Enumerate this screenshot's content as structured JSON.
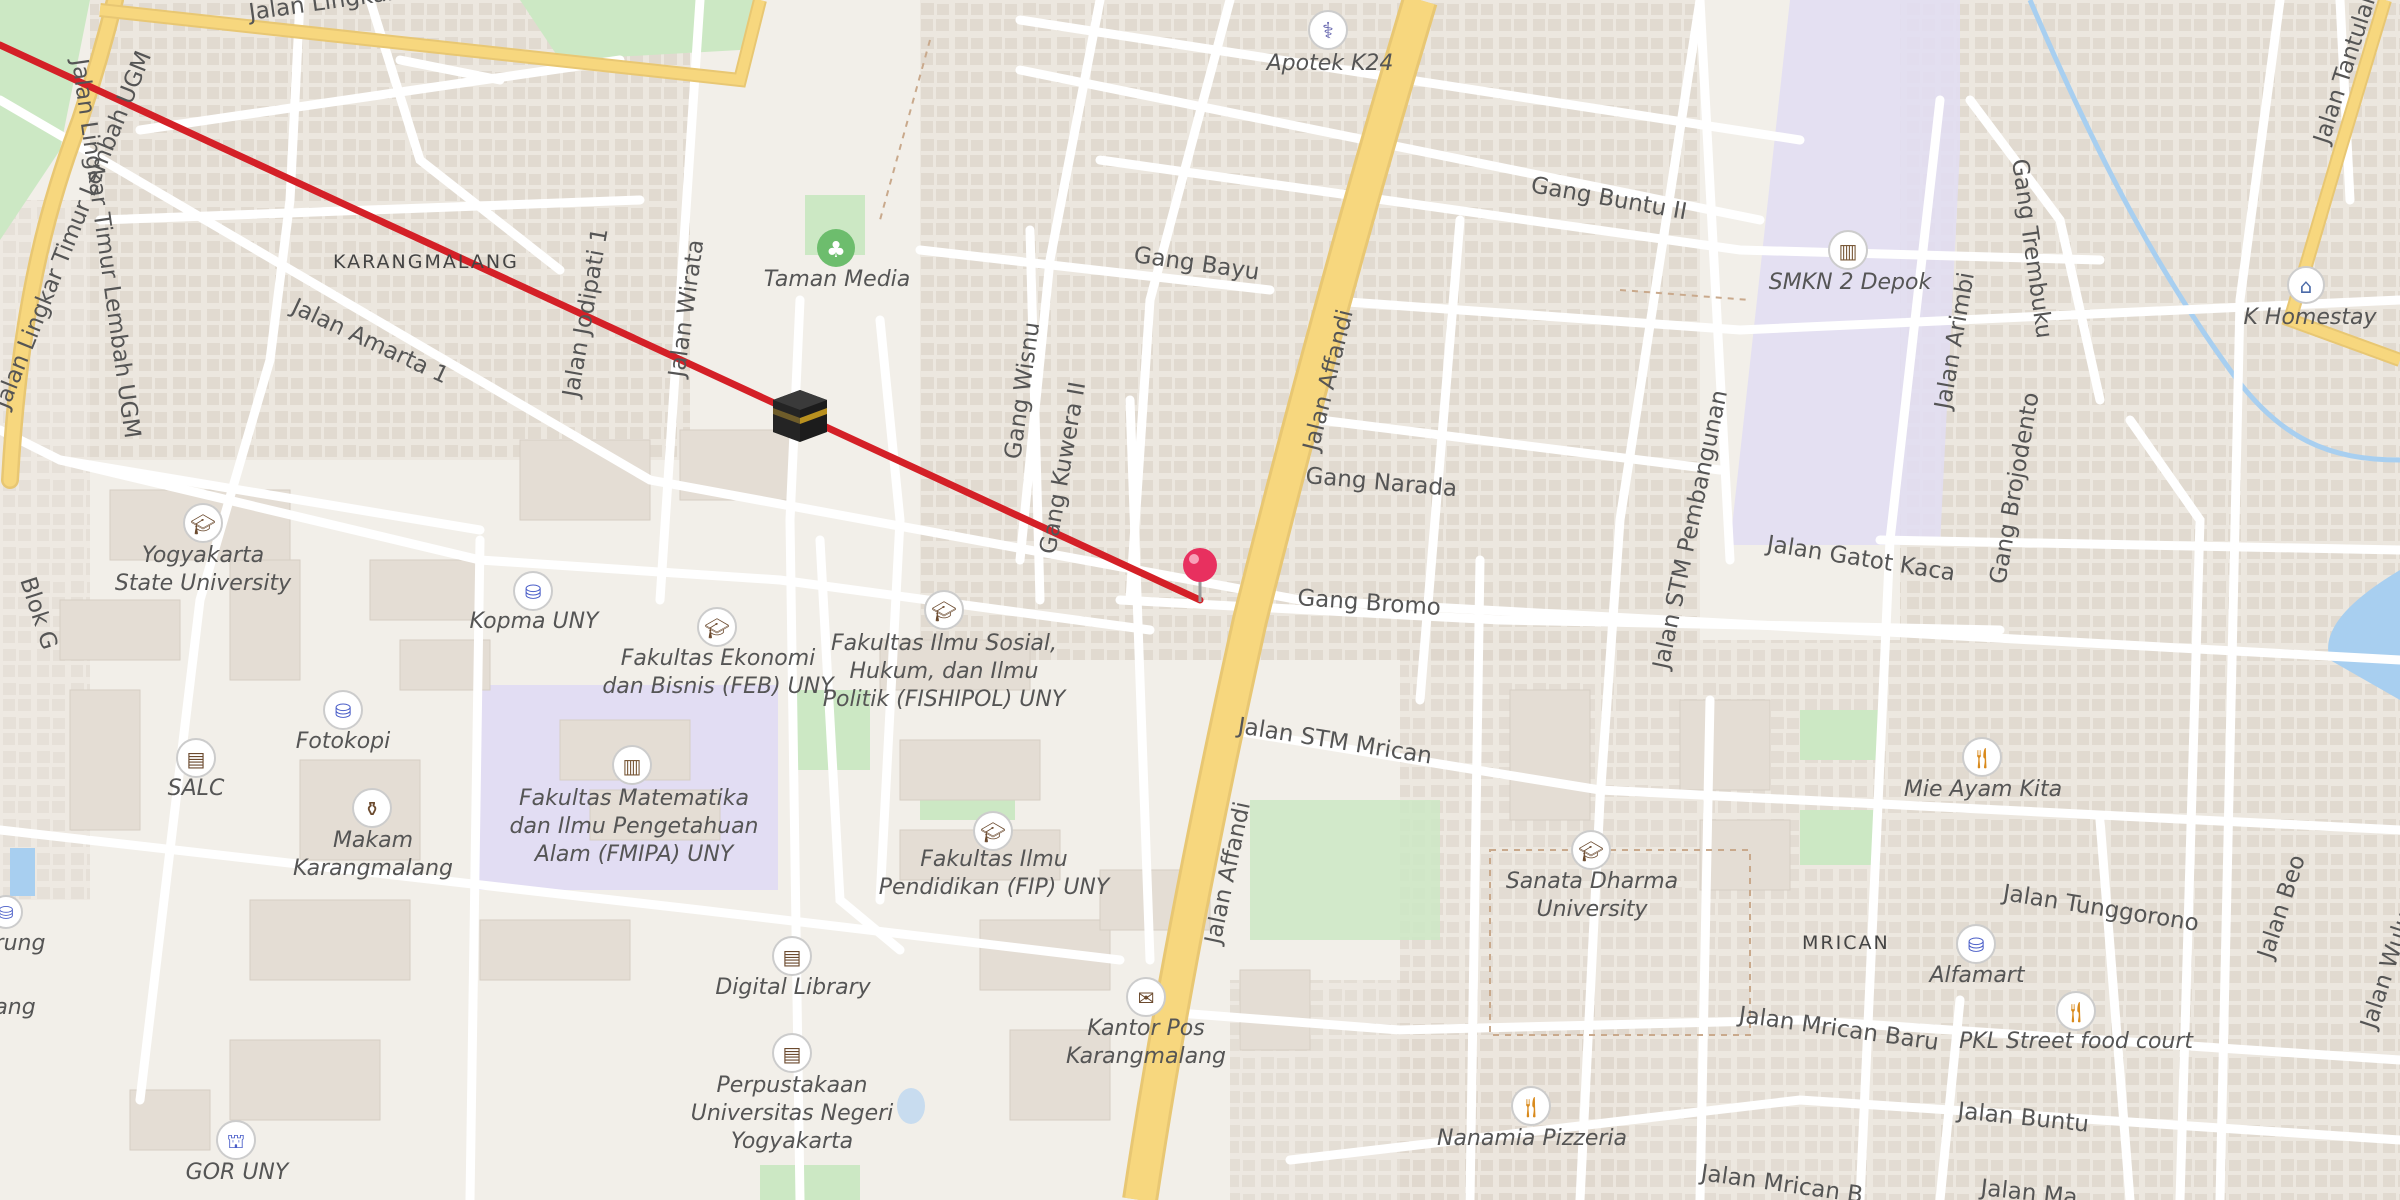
{
  "map": {
    "areas": {
      "karangmalang": "KARANGMALANG",
      "mrican": "MRICAN"
    },
    "roads": {
      "lembah_ugm_top": "Jalan Lingkar Timur Lembah UGM",
      "lembah_ugm_left": "Jalan Lingkar Timur Lembah UGM",
      "lembah_ugm_left2": "Jalan Lingkar Timur Lembah UGM",
      "amarta": "Jalan Amarta 1",
      "jodipati": "Jalan Jodipati 1",
      "wirata": "Jalan Wirata",
      "blok_g": "Blok G",
      "gang_wisnu": "Gang Wisnu",
      "gang_kuwera": "Gang Kuwera II",
      "gang_bayu": "Gang Bayu",
      "affandi_top": "Jalan Affandi",
      "affandi_bottom": "Jalan Affandi",
      "gang_buntu_2": "Gang Buntu II",
      "gang_narada": "Gang Narada",
      "gang_bromo": "Gang Bromo",
      "gatot_kaca": "Jalan Gatot Kaca",
      "stm_pembangunan": "Jalan STM Pembangunan",
      "stm_mrican": "Jalan STM Mrican",
      "arimbi": "Jalan Arimbi",
      "gang_trembuku": "Gang Trembuku",
      "gang_brojodento": "Gang Brojodento",
      "tantular": "Jalan Tantular",
      "tunggorono": "Jalan Tunggorono",
      "beo": "Jalan Beo",
      "wulung": "Jalan Wulung",
      "mrican_baru": "Jalan Mrican Baru",
      "buntu": "Jalan Buntu",
      "mrican_bottom": "Jalan Mrican B",
      "mana_bottom": "Jalan Ma"
    },
    "pois": {
      "apotek": "Apotek K24",
      "taman_media": "Taman Media",
      "smkn2": "SMKN 2 Depok",
      "homestay": "K Homestay",
      "uny_1": "Yogyakarta",
      "uny_2": "State University",
      "kopma": "Kopma UNY",
      "feb_1": "Fakultas Ekonomi",
      "feb_2": "dan Bisnis (FEB) UNY",
      "fishipol_1": "Fakultas Ilmu Sosial,",
      "fishipol_2": "Hukum, dan Ilmu",
      "fishipol_3": "Politik (FISHIPOL) UNY",
      "fotokopi": "Fotokopi",
      "salc": "SALC",
      "makam_1": "Makam",
      "makam_2": "Karangmalang",
      "fmipa_1": "Fakultas Matematika",
      "fmipa_2": "dan Ilmu Pengetahuan",
      "fmipa_3": "Alam (FMIPA) UNY",
      "fip_1": "Fakultas Ilmu",
      "fip_2": "Pendidikan (FIP) UNY",
      "digital_library": "Digital Library",
      "kantor_pos_1": "Kantor Pos",
      "kantor_pos_2": "Karangmalang",
      "perpus_1": "Perpustakaan",
      "perpus_2": "Universitas Negeri",
      "perpus_3": "Yogyakarta",
      "gor": "GOR UNY",
      "sanata_1": "Sanata Dharma",
      "sanata_2": "University",
      "mie_ayam": "Mie Ayam Kita",
      "alfamart": "Alfamart",
      "pkl": "PKL Street food court",
      "nanamia": "Nanamia Pizzeria",
      "edge_1": "rung",
      "edge_2": "ang"
    },
    "colors": {
      "background": "#f2efe9",
      "building": "#e4ddd4",
      "road": "#ffffff",
      "main_road": "#f7d77e",
      "park": "#cce8c4",
      "school": "#e2ddf3",
      "water": "#a8cff0",
      "route_line": "#d42027",
      "pin": "#e8305f"
    },
    "markers": {
      "kaaba": "kaaba-icon",
      "pin": "map-pin-icon"
    }
  }
}
